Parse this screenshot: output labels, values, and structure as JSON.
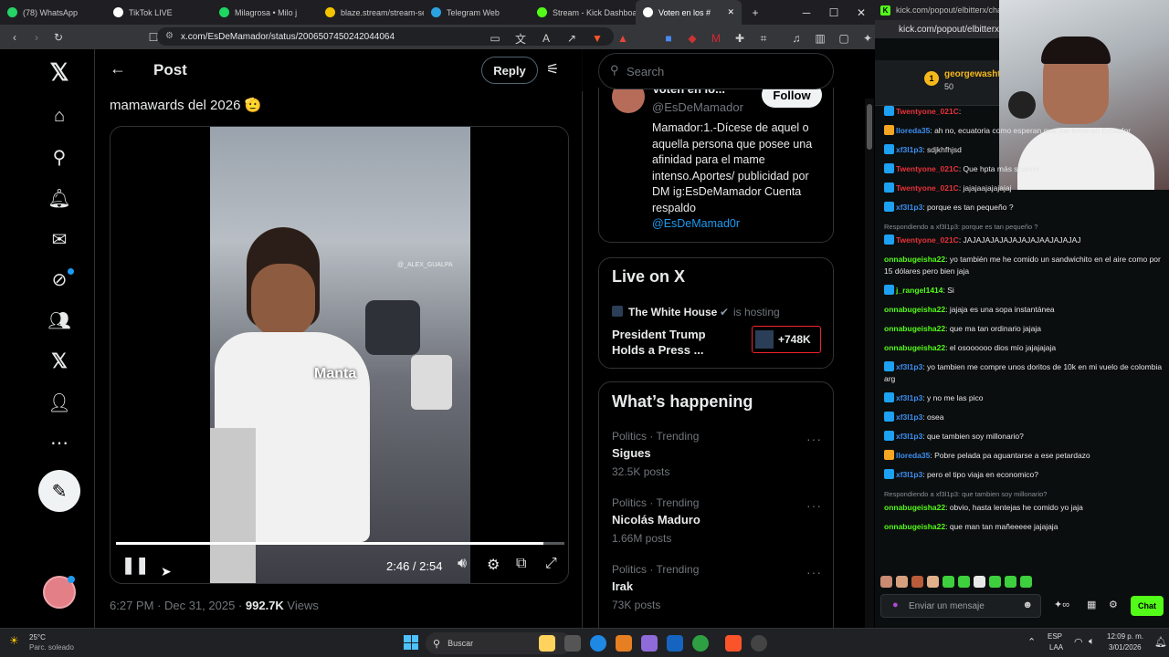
{
  "browser": {
    "tabs": [
      {
        "label": "(78) WhatsApp",
        "color": "#25d366"
      },
      {
        "label": "TikTok LIVE",
        "color": "#ffffff"
      },
      {
        "label": "Milagrosa • Milo j",
        "color": "#1ed760"
      },
      {
        "label": "blaze.stream/stream-se",
        "color": "#f5c400"
      },
      {
        "label": "Telegram Web",
        "color": "#2aa3e0"
      },
      {
        "label": "Stream - Kick Dashboa",
        "color": "#53fc18"
      },
      {
        "label": "Voten en los #",
        "color": "#ffffff"
      }
    ],
    "url": "x.com/EsDeMamador/status/2006507450242044064"
  },
  "x": {
    "header": {
      "title": "Post",
      "reply_label": "Reply"
    },
    "tweet_text": "mamawards del 2026 🫡",
    "video": {
      "overlay_text": "Manta",
      "watermark": "@_ALEX_GUALPA",
      "time": "2:46 / 2:54",
      "progress": 0.953
    },
    "meta": {
      "time": "6:27 PM · Dec 31, 2025",
      "views": "992.7K",
      "views_label": "Views"
    },
    "search_placeholder": "Search",
    "profile": {
      "name": "Voten en lo...",
      "handle": "@EsDeMamador",
      "follow_label": "Follow",
      "bio": "Mamador:1.-Dícese de aquel o aquella persona que posee una afinidad para el mame intenso.Aportes/ publicidad por DM ig:EsDeMamador Cuenta respaldo",
      "bio_link": "@EsDeMamad0r"
    },
    "live": {
      "heading": "Live on X",
      "host": "The White House",
      "hosting_label": "is hosting",
      "title": "President Trump Holds a Press ...",
      "count": "+748K"
    },
    "happening": {
      "heading": "What’s happening",
      "trends": [
        {
          "meta": "Politics · Trending",
          "name": "Sigues",
          "posts": "32.5K posts"
        },
        {
          "meta": "Politics · Trending",
          "name": "Nicolás Maduro",
          "posts": "1.66M posts"
        },
        {
          "meta": "Politics · Trending",
          "name": "Irak",
          "posts": "73K posts"
        }
      ]
    }
  },
  "kick": {
    "tab_label": "kick.com/popout/elbitterx/chat - K",
    "url": "kick.com/popout/elbitterx/chat",
    "pinned": {
      "user": "georgewasht",
      "amount": "50"
    },
    "messages": [
      {
        "user": "Twentyone_021C",
        "color": "#e8323a",
        "text": "",
        "badge": "#1da1f2"
      },
      {
        "user": "lloreda35",
        "color": "#3b8ef0",
        "text": "ah no, ecuatoria como esperan que me tome en Ecuador",
        "badge": "#f5a623"
      },
      {
        "user": "xf3l1p3",
        "color": "#3b8ef0",
        "text": "sdjkhfhjsd",
        "badge": "#1da1f2"
      },
      {
        "user": "Twentyone_021C",
        "color": "#e8323a",
        "text": "Que hpta más scamer",
        "badge": "#1da1f2"
      },
      {
        "user": "Twentyone_021C",
        "color": "#e8323a",
        "text": "jajajaajajajajaj",
        "badge": "#1da1f2"
      },
      {
        "user": "xf3l1p3",
        "color": "#3b8ef0",
        "text": "porque es tan pequeño ?",
        "badge": "#1da1f2"
      },
      {
        "reply": "Respondiendo a xf3l1p3: porque es tan pequeño ?",
        "user": "Twentyone_021C",
        "color": "#e8323a",
        "text": "JAJAJAJAJAJAJAJAJAAJAJAJAJ",
        "badge": "#1da1f2"
      },
      {
        "user": "onnabugeisha22",
        "color": "#53fc18",
        "text": "yo también me he comido un sandwichito en el aire como por 15 dólares pero bien jaja",
        "badge": ""
      },
      {
        "user": "j_rangel1414",
        "color": "#53fc18",
        "text": "Si",
        "badge": "#1da1f2"
      },
      {
        "user": "onnabugeisha22",
        "color": "#53fc18",
        "text": "jajaja es una sopa instantánea",
        "badge": ""
      },
      {
        "user": "onnabugeisha22",
        "color": "#53fc18",
        "text": "que ma tan ordinario jajaja",
        "badge": ""
      },
      {
        "user": "onnabugeisha22",
        "color": "#53fc18",
        "text": "el osoooooo dios mío jajajajaja",
        "badge": ""
      },
      {
        "user": "xf3l1p3",
        "color": "#3b8ef0",
        "text": "yo tambien me compre unos doritos de 10k en mi vuelo de colombia arg",
        "badge": "#1da1f2"
      },
      {
        "user": "xf3l1p3",
        "color": "#3b8ef0",
        "text": "y no me las pico",
        "badge": "#1da1f2"
      },
      {
        "user": "xf3l1p3",
        "color": "#3b8ef0",
        "text": "osea",
        "badge": "#1da1f2"
      },
      {
        "user": "xf3l1p3",
        "color": "#3b8ef0",
        "text": "que tambien soy millonario?",
        "badge": "#1da1f2"
      },
      {
        "user": "lloreda35",
        "color": "#3b8ef0",
        "text": "Pobre pelada pa aguantarse a ese petardazo",
        "badge": "#f5a623"
      },
      {
        "user": "xf3l1p3",
        "color": "#3b8ef0",
        "text": "pero el tipo viaja en economico?",
        "badge": "#1da1f2"
      },
      {
        "reply": "Respondiendo a xf3l1p3: que tambien soy millonario?",
        "user": "onnabugeisha22",
        "color": "#53fc18",
        "text": "obvio, hasta lentejas he comido yo jaja",
        "badge": ""
      },
      {
        "user": "onnabugeisha22",
        "color": "#53fc18",
        "text": "que man tan mañeeeee jajajaja",
        "badge": ""
      }
    ],
    "input_placeholder": "Enviar un mensaje",
    "chat_button": "Chat"
  },
  "taskbar": {
    "weather_temp": "25°C",
    "weather_desc": "Parc. soleado",
    "search_label": "Buscar",
    "lang": "ESP",
    "lang2": "LAA",
    "time": "12:09 p. m.",
    "date": "3/01/2026"
  }
}
